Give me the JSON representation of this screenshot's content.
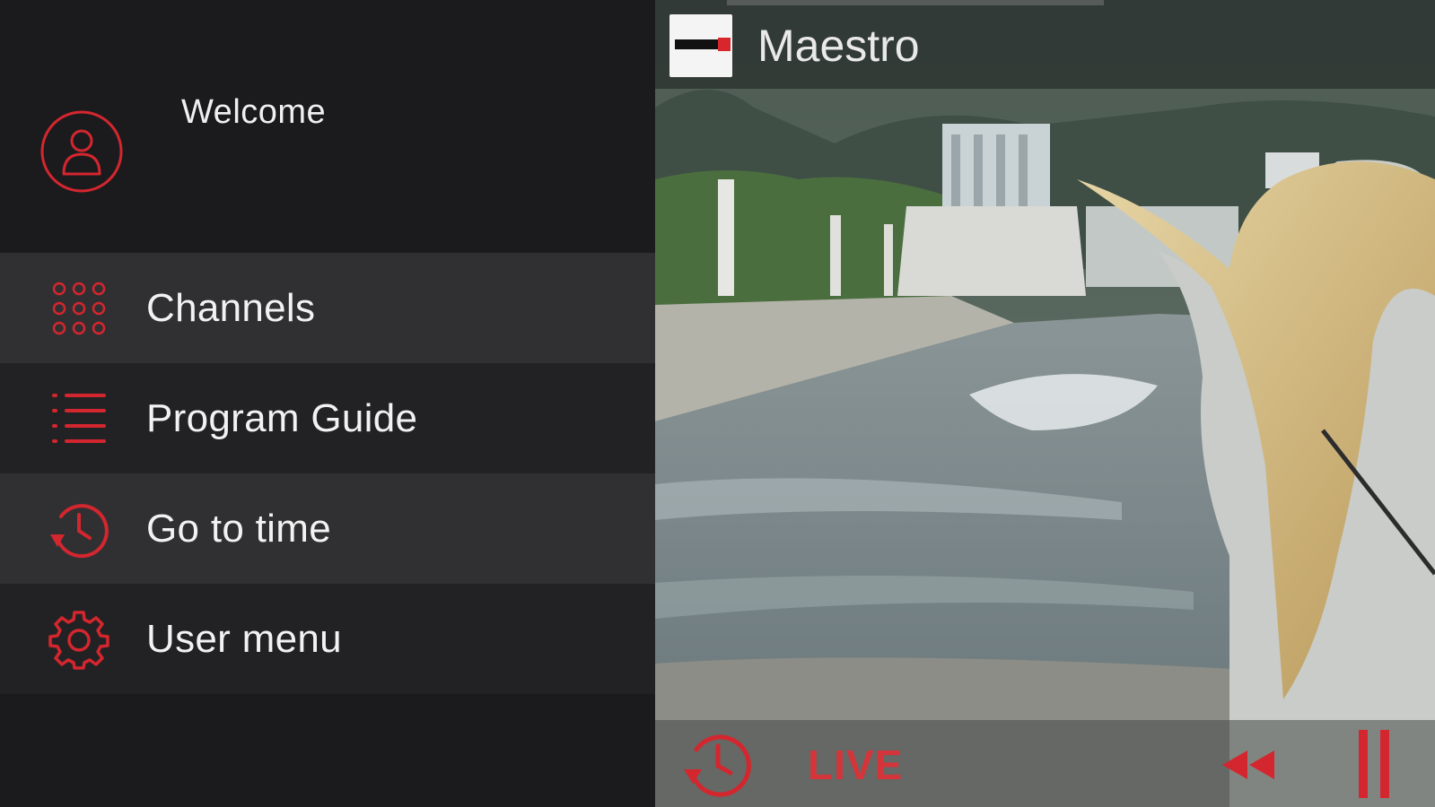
{
  "sidebar": {
    "welcome_text": "Welcome",
    "avatar_icon": "user-circle-icon",
    "items": [
      {
        "label": "Channels",
        "icon": "grid-dots-icon"
      },
      {
        "label": "Program Guide",
        "icon": "list-icon"
      },
      {
        "label": "Go to time",
        "icon": "history-clock-icon"
      },
      {
        "label": "User menu",
        "icon": "gear-icon"
      }
    ]
  },
  "player": {
    "channel_name": "Maestro",
    "live_label": "LIVE",
    "controls": [
      "timeshift-clock-icon",
      "rewind-icon",
      "pause-icon"
    ]
  },
  "colors": {
    "accent": "#d4262e",
    "sidebar_bg": "#1b1b1e",
    "item_light": "#303032",
    "item_dark": "#222224",
    "text": "#f2f2f2"
  }
}
